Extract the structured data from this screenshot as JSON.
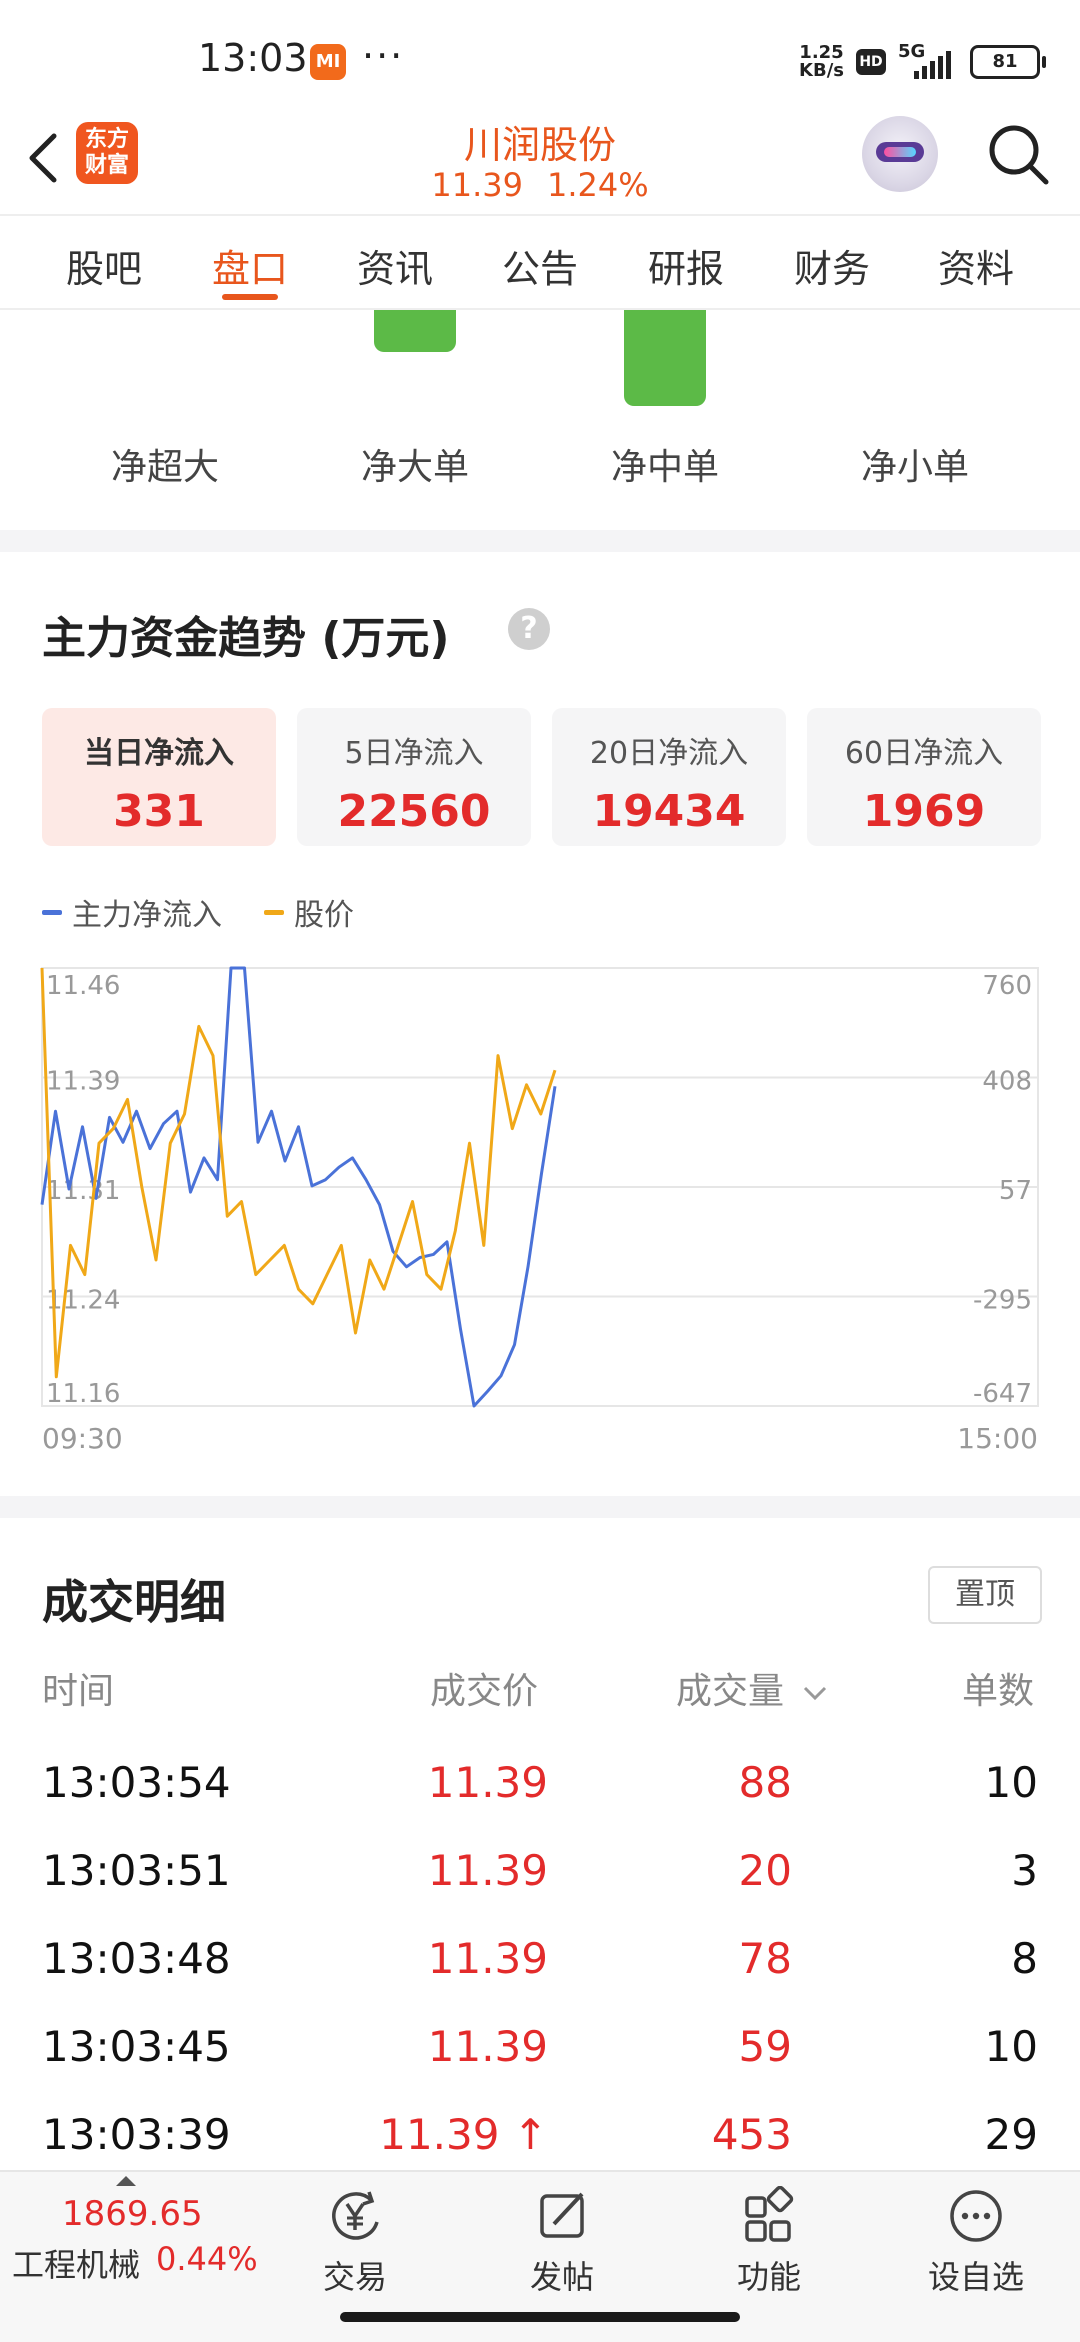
{
  "status_bar": {
    "time": "13:03",
    "mi_icon": "MI",
    "dots": "···",
    "speed": "1.25\nKB/s",
    "hd": "HD",
    "network": "5G",
    "battery": "81"
  },
  "header": {
    "logo_text": "东方\n财富",
    "stock_name": "川润股份",
    "price": "11.39",
    "change_pct": "1.24%",
    "back_icon": "chevron-left-icon",
    "search_icon": "search-icon",
    "avatar_icon": "robot-avatar-icon"
  },
  "tabs": [
    "股吧",
    "盘口",
    "资讯",
    "公告",
    "研报",
    "财务",
    "资料"
  ],
  "active_tab": "盘口",
  "flow_bars": {
    "labels": [
      "净超大",
      "净大单",
      "净中单",
      "净小单"
    ]
  },
  "trend": {
    "title": "主力资金趋势 (万元)",
    "help": "?",
    "cards": [
      {
        "label": "当日净流入",
        "value": "331",
        "active": true
      },
      {
        "label": "5日净流入",
        "value": "22560",
        "active": false
      },
      {
        "label": "20日净流入",
        "value": "19434",
        "active": false
      },
      {
        "label": "60日净流入",
        "value": "1969",
        "active": false
      }
    ],
    "legend": [
      {
        "name": "主力净流入",
        "color": "#4a72d8"
      },
      {
        "name": "股价",
        "color": "#f0a818"
      }
    ]
  },
  "chart_data": {
    "type": "line",
    "title": "",
    "x_labels": [
      "09:30",
      "15:00"
    ],
    "y_left_ticks": [
      "11.46",
      "11.39",
      "11.31",
      "11.24",
      "11.16"
    ],
    "y_right_ticks": [
      "760",
      "408",
      "57",
      "-295",
      "-647"
    ],
    "ylim_left": [
      11.16,
      11.46
    ],
    "ylim_right": [
      -647,
      760
    ],
    "grid": true,
    "series": [
      {
        "name": "主力净流入",
        "color": "#4a72d8",
        "axis": "right",
        "values": [
          0,
          300,
          50,
          250,
          20,
          280,
          200,
          300,
          180,
          260,
          300,
          40,
          150,
          80,
          900,
          780,
          200,
          300,
          140,
          250,
          60,
          80,
          120,
          150,
          80,
          0,
          -150,
          -200,
          -170,
          -160,
          -120,
          -400,
          -650,
          -600,
          -550,
          -450,
          -200,
          100,
          380
        ]
      },
      {
        "name": "股价",
        "color": "#f0a818",
        "axis": "left",
        "values": [
          11.46,
          11.18,
          11.27,
          11.25,
          11.34,
          11.35,
          11.37,
          11.31,
          11.26,
          11.34,
          11.36,
          11.42,
          11.4,
          11.29,
          11.3,
          11.25,
          11.26,
          11.27,
          11.24,
          11.23,
          11.25,
          11.27,
          11.21,
          11.26,
          11.24,
          11.27,
          11.3,
          11.25,
          11.24,
          11.28,
          11.34,
          11.27,
          11.4,
          11.35,
          11.38,
          11.36,
          11.39
        ]
      }
    ]
  },
  "trades": {
    "title": "成交明细",
    "pin_label": "置顶",
    "columns": [
      "时间",
      "成交价",
      "成交量",
      "单数"
    ],
    "rows": [
      {
        "time": "13:03:54",
        "price": "11.39",
        "volume": "88",
        "count": "10",
        "up": false
      },
      {
        "time": "13:03:51",
        "price": "11.39",
        "volume": "20",
        "count": "3",
        "up": false
      },
      {
        "time": "13:03:48",
        "price": "11.39",
        "volume": "78",
        "count": "8",
        "up": false
      },
      {
        "time": "13:03:45",
        "price": "11.39",
        "volume": "59",
        "count": "10",
        "up": false
      },
      {
        "time": "13:03:39",
        "price": "11.39 ↑",
        "volume": "453",
        "count": "29",
        "up": true
      }
    ]
  },
  "bottom_bar": {
    "index_value": "1869.65",
    "index_name": "工程机械",
    "index_pct": "0.44%",
    "items": [
      {
        "label": "交易",
        "icon": "trade-yen-icon"
      },
      {
        "label": "发帖",
        "icon": "compose-post-icon"
      },
      {
        "label": "功能",
        "icon": "grid-apps-icon"
      },
      {
        "label": "设自选",
        "icon": "more-dots-icon"
      }
    ]
  },
  "colors": {
    "accent": "#e8561d",
    "up_red": "#e32b2b",
    "down_green": "#5cba47",
    "main_flow_blue": "#4a72d8",
    "price_orange": "#f0a818"
  }
}
